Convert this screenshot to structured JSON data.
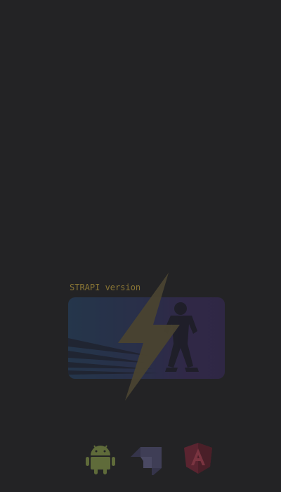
{
  "splash": {
    "version_label": "STRAPI version"
  },
  "hero": {
    "illustration": "superhero-silhouette",
    "accent_icon": "lightning-bolt-icon"
  },
  "tech_stack": [
    {
      "name": "android-icon",
      "color": "#5f6b3a"
    },
    {
      "name": "strapi-icon",
      "color": "#3f3e56"
    },
    {
      "name": "angular-icon",
      "color": "#5a2430"
    }
  ],
  "colors": {
    "background": "#232325",
    "label": "#8a7635",
    "bolt": "#4a4330"
  }
}
